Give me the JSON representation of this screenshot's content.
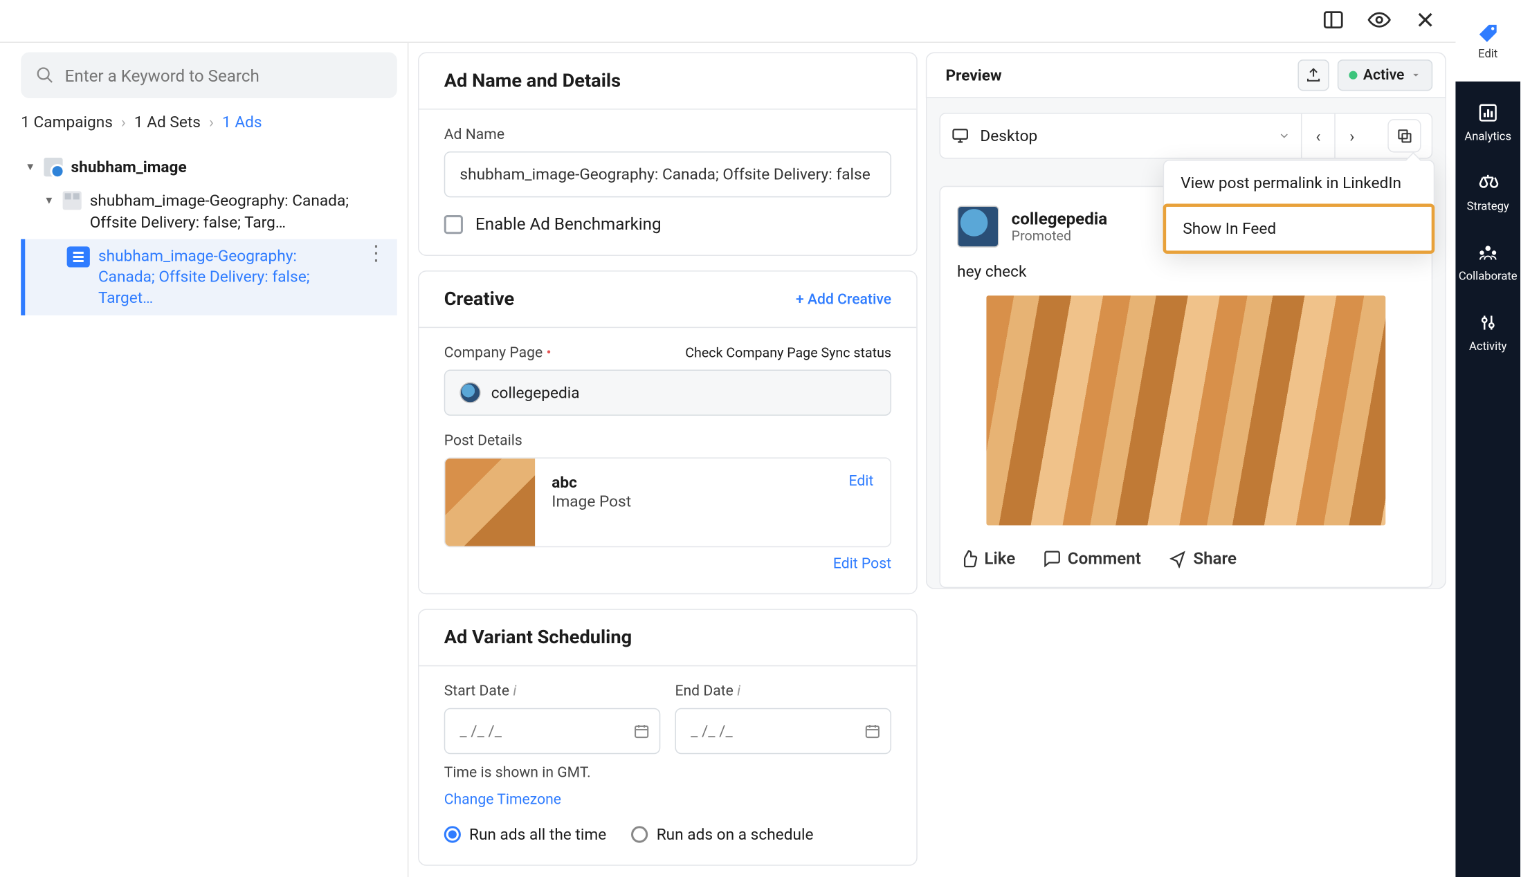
{
  "topbar": {},
  "rightrail": {
    "edit": "Edit",
    "items": [
      {
        "label": "Analytics"
      },
      {
        "label": "Strategy"
      },
      {
        "label": "Collaborate"
      },
      {
        "label": "Activity"
      }
    ]
  },
  "search": {
    "placeholder": "Enter a Keyword to Search"
  },
  "breadcrumbs": {
    "campaigns": "1 Campaigns",
    "adsets": "1 Ad Sets",
    "ads": "1 Ads"
  },
  "tree": {
    "campaign": {
      "name": "shubham_image"
    },
    "adset": {
      "name": "shubham_image-Geography: Canada; Offsite Delivery: false; Targ…"
    },
    "ad": {
      "name": "shubham_image-Geography: Canada; Offsite Delivery: false; Target…"
    }
  },
  "ad_details": {
    "heading": "Ad Name and Details",
    "name_label": "Ad Name",
    "name_value": "shubham_image-Geography: Canada; Offsite Delivery: false",
    "benchmark_label": "Enable Ad Benchmarking"
  },
  "creative": {
    "heading": "Creative",
    "add_link": "+ Add Creative",
    "company_page_label": "Company Page",
    "company_page_sync_link": "Check Company Page Sync status",
    "company_page_value": "collegepedia",
    "post_details_label": "Post Details",
    "post_title": "abc",
    "post_type": "Image Post",
    "post_edit": "Edit",
    "edit_post_link": "Edit Post"
  },
  "scheduling": {
    "heading": "Ad Variant Scheduling",
    "start_label": "Start Date",
    "end_label": "End Date",
    "date_placeholder": "_ /_ /_",
    "tz_note": "Time is shown in GMT.",
    "tz_link": "Change Timezone",
    "opt_all": "Run ads all the time",
    "opt_schedule": "Run ads on a schedule"
  },
  "preview": {
    "heading": "Preview",
    "status": "Active",
    "device": "Desktop",
    "popover": {
      "permalink": "View post permalink in LinkedIn",
      "show_feed": "Show In Feed"
    },
    "post": {
      "author": "collegepedia",
      "promoted": "Promoted",
      "text": "hey check",
      "like": "Like",
      "comment": "Comment",
      "share": "Share"
    }
  }
}
